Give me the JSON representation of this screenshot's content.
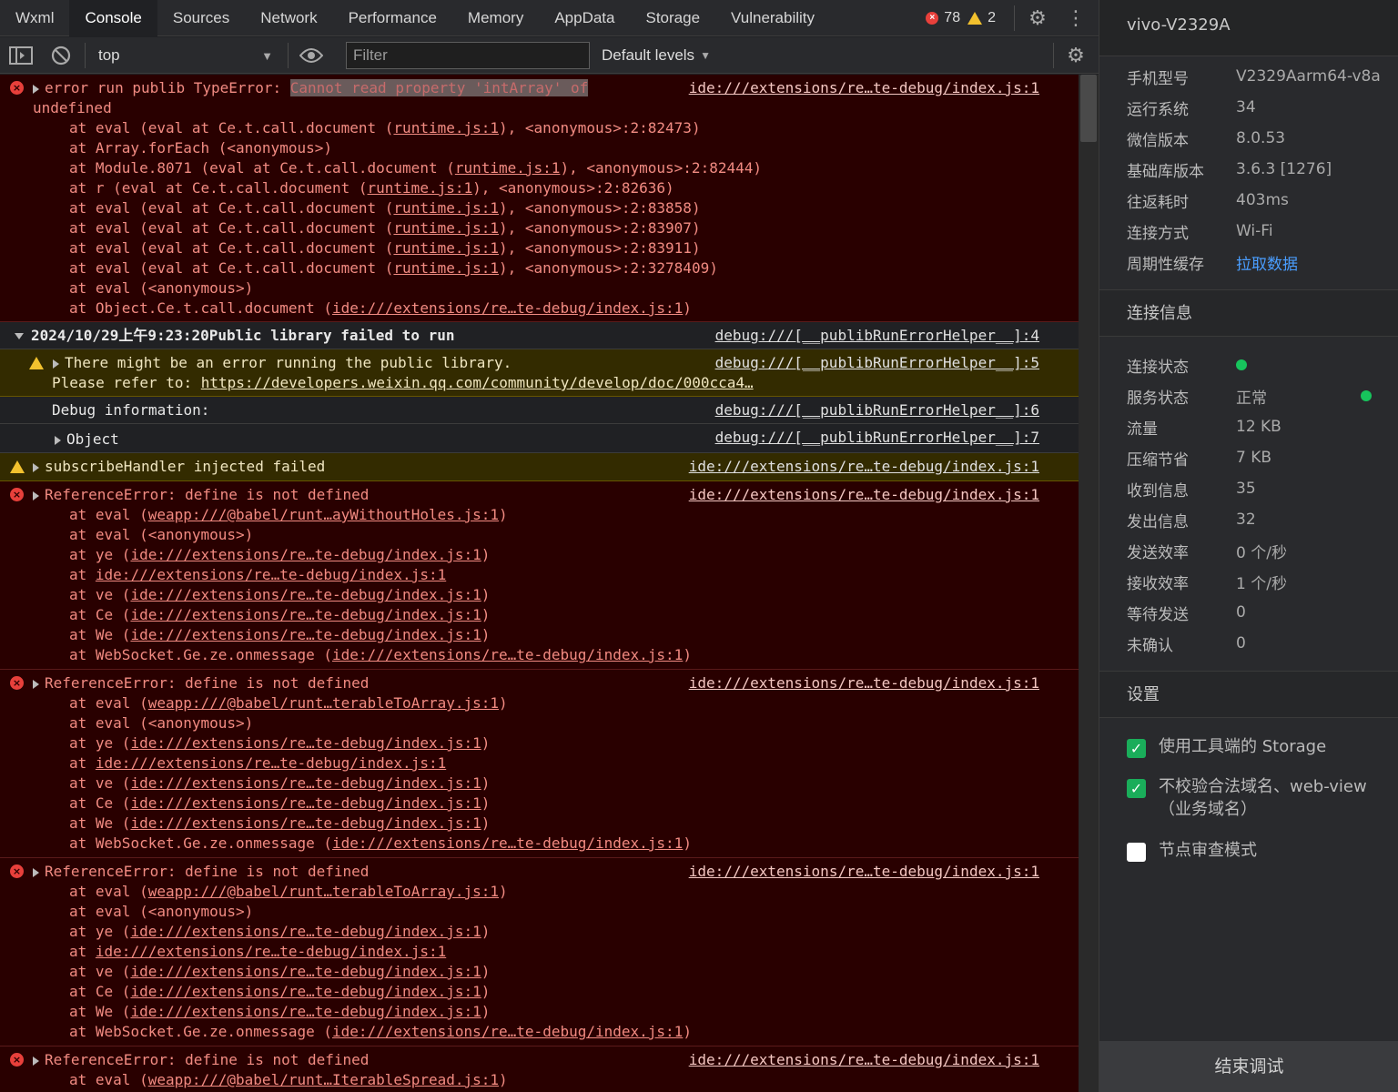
{
  "tabs": [
    "Wxml",
    "Console",
    "Sources",
    "Network",
    "Performance",
    "Memory",
    "AppData",
    "Storage",
    "Vulnerability"
  ],
  "counts": {
    "errors": "78",
    "warnings": "2"
  },
  "toolbar": {
    "context": "top",
    "filter_placeholder": "Filter",
    "levels": "Default levels"
  },
  "log": {
    "m1": {
      "prefix": "error run publib TypeError: ",
      "highlight": "Cannot read property 'intArray' of",
      "cont": "undefined",
      "src": "ide:///extensions/re…te-debug/index.js:1",
      "f1a": "at eval (eval at Ce.t.call.document (",
      "f1b": "runtime.js:1",
      "f1c": "), <anonymous>:2:82473)",
      "f2": "at Array.forEach (<anonymous>)",
      "f3a": "at Module.8071 (eval at Ce.t.call.document (",
      "f3b": "runtime.js:1",
      "f3c": "), <anonymous>:2:82444)",
      "f4a": "at r (eval at Ce.t.call.document (",
      "f4b": "runtime.js:1",
      "f4c": "), <anonymous>:2:82636)",
      "f5a": "at eval (eval at Ce.t.call.document (",
      "f5b": "runtime.js:1",
      "f5c": "), <anonymous>:2:83858)",
      "f6a": "at eval (eval at Ce.t.call.document (",
      "f6b": "runtime.js:1",
      "f6c": "), <anonymous>:2:83907)",
      "f7a": "at eval (eval at Ce.t.call.document (",
      "f7b": "runtime.js:1",
      "f7c": "), <anonymous>:2:83911)",
      "f8a": "at eval (eval at Ce.t.call.document (",
      "f8b": "runtime.js:1",
      "f8c": "), <anonymous>:2:3278409)",
      "f9": "at eval (<anonymous>)",
      "f10a": "at Object.Ce.t.call.document (",
      "f10b": "ide:///extensions/re…te-debug/index.js:1",
      "f10c": ")"
    },
    "grp": {
      "title": "2024/10/29上午9:23:20Public library failed to run",
      "src": "debug:///[__publibRunErrorHelper__]:4",
      "w1": "There might be an error running the public library.",
      "w2a": "Please refer to: ",
      "w2b": "https://developers.weixin.qq.com/community/develop/doc/000cca4…",
      "w1src": "debug:///[__publibRunErrorHelper__]:5",
      "d1": "Debug information:",
      "d1src": "debug:///[__publibRunErrorHelper__]:6",
      "d2": "Object",
      "d2src": "debug:///[__publibRunErrorHelper__]:7"
    },
    "warn2": {
      "text": "subscribeHandler injected failed",
      "src": "ide:///extensions/re…te-debug/index.js:1"
    },
    "ref": {
      "text": "ReferenceError: define is not defined",
      "src": "ide:///extensions/re…te-debug/index.js:1",
      "at": "at ",
      "eval": "eval (",
      "anon": "at eval (<anonymous>)",
      "ye": "ye (",
      "ve": "ve (",
      "ce": "Ce (",
      "we": "We (",
      "ws": "WebSocket.Ge.ze.onmessage (",
      "idx": "ide:///extensions/re…te-debug/index.js:1",
      "close": ")",
      "b1": "weapp:///@babel/runt…ayWithoutHoles.js:1",
      "b2": "weapp:///@babel/runt…terableToArray.js:1",
      "b3": "weapp:///@babel/runt…terableToArray.js:1",
      "b4": "weapp:///@babel/runt…IterableSpread.js:1"
    }
  },
  "device": {
    "name": "vivo-V2329A"
  },
  "info": [
    {
      "k": "手机型号",
      "v": "V2329Aarm64-v8a"
    },
    {
      "k": "运行系统",
      "v": "34"
    },
    {
      "k": "微信版本",
      "v": "8.0.53"
    },
    {
      "k": "基础库版本",
      "v": "3.6.3 [1276]"
    },
    {
      "k": "往返耗时",
      "v": "403ms"
    },
    {
      "k": "连接方式",
      "v": "Wi-Fi"
    },
    {
      "k": "周期性缓存",
      "v": "拉取数据"
    }
  ],
  "conn_title": "连接信息",
  "conn": [
    {
      "k": "连接状态",
      "v": ""
    },
    {
      "k": "服务状态",
      "v": "正常"
    },
    {
      "k": "流量",
      "v": "12 KB"
    },
    {
      "k": "压缩节省",
      "v": "7 KB"
    },
    {
      "k": "收到信息",
      "v": "35"
    },
    {
      "k": "发出信息",
      "v": "32"
    },
    {
      "k": "发送效率",
      "v": "0 个/秒"
    },
    {
      "k": "接收效率",
      "v": "1 个/秒"
    },
    {
      "k": "等待发送",
      "v": "0"
    },
    {
      "k": "未确认",
      "v": "0"
    }
  ],
  "settings_title": "设置",
  "settings": [
    {
      "label": "使用工具端的 Storage",
      "checked": true
    },
    {
      "label": "不校验合法域名、web-view（业务域名）",
      "checked": true
    },
    {
      "label": "节点审查模式",
      "checked": false
    }
  ],
  "end_button": "结束调试",
  "colors": {
    "error_bg": "#290000",
    "warn_bg": "#332b00",
    "accent_green": "#1aad5a",
    "link_blue": "#4a9eff"
  }
}
